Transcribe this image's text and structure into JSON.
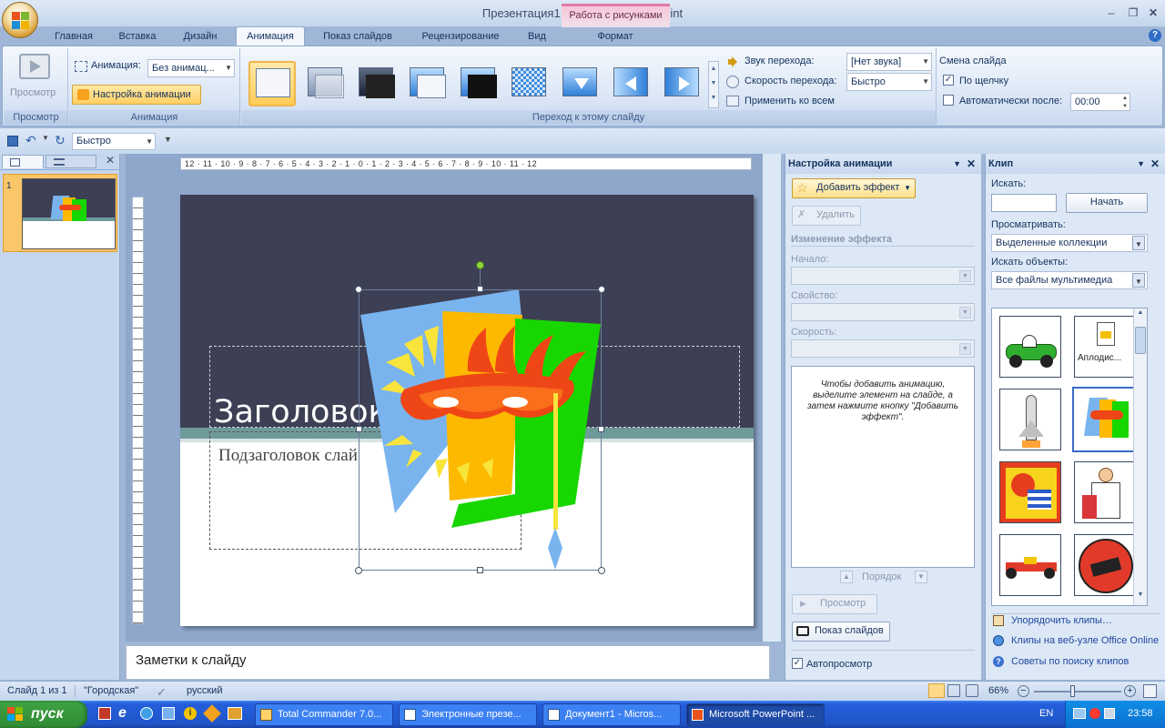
{
  "window": {
    "title": "Презентация1 - Microsoft PowerPoint",
    "context_tab_title": "Работа с рисунками"
  },
  "tabs": [
    "Главная",
    "Вставка",
    "Дизайн",
    "Анимация",
    "Показ слайдов",
    "Рецензирование",
    "Вид",
    "Формат"
  ],
  "active_tab": "Анимация",
  "ribbon": {
    "preview_label": "Просмотр",
    "preview_group": "Просмотр",
    "animation_label": "Анимация:",
    "animation_value": "Без анимац...",
    "custom_animation_label": "Настройка анимации",
    "animation_group": "Анимация",
    "transition_group": "Переход к этому слайду",
    "sound_label": "Звук перехода:",
    "sound_value": "[Нет звука]",
    "speed_label": "Скорость перехода:",
    "speed_value": "Быстро",
    "apply_all_label": "Применить ко всем",
    "advance_title": "Смена слайда",
    "on_click_label": "По щелчку",
    "on_click_checked": true,
    "auto_after_label": "Автоматически после:",
    "auto_after_checked": false,
    "auto_after_value": "00:00"
  },
  "qat": {
    "speed_value": "Быстро"
  },
  "slide": {
    "number": "1",
    "title": "Заголовок",
    "subtitle": "Подзаголовок слай",
    "notes_placeholder": "Заметки к слайду"
  },
  "ruler": {
    "h_ticks": "12 · 11 · 10 · 9 · 8 · 7 · 6 · 5 · 4 · 3 · 2 · 1 · 0 · 1 · 2 · 3 · 4 · 5 · 6 · 7 · 8 · 9 · 10 · 11 · 12"
  },
  "anim_pane": {
    "title": "Настройка анимации",
    "add_effect": "Добавить эффект",
    "remove": "Удалить",
    "change_effect": "Изменение эффекта",
    "start_label": "Начало:",
    "property_label": "Свойство:",
    "speed_label": "Скорость:",
    "hint": "Чтобы добавить анимацию, выделите элемент на слайде, а затем нажмите кнопку \"Добавить эффект\".",
    "order_label": "Порядок",
    "preview_button": "Просмотр",
    "slideshow_button": "Показ слайдов",
    "autopreview_label": "Автопросмотр",
    "autopreview_checked": true
  },
  "clip_pane": {
    "title": "Клип",
    "search_label": "Искать:",
    "search_value": "",
    "go_button": "Начать",
    "browse_label": "Просматривать:",
    "browse_value": "Выделенные коллекции",
    "find_label": "Искать объекты:",
    "find_value": "Все файлы мультимедиа",
    "clips": [
      "race car",
      "Аплодис...",
      "space shuttle",
      "carnival mask",
      "party balloons",
      "doctor and child",
      "formula car",
      "books and apple"
    ],
    "selected_clip": "carnival mask",
    "organize_link": "Упорядочить клипы…",
    "online_link": "Клипы на веб-узле Office Online",
    "tips_link": "Советы по поиску клипов"
  },
  "status": {
    "slide_info": "Слайд 1 из 1",
    "theme": "\"Городская\"",
    "language": "русский",
    "zoom": "66%"
  },
  "taskbar": {
    "start_label": "пуск",
    "tasks": [
      "Total Commander 7.0...",
      "Электронные презе...",
      "Документ1 - Micros...",
      "Microsoft PowerPoint ..."
    ],
    "active_task": "Microsoft PowerPoint ...",
    "lang": "EN",
    "clock": "23:58"
  },
  "colors": {
    "slide_top": "#3d3f55",
    "slide_band": "#6f9a9a",
    "accent_orange": "#f7b235",
    "mask_blue": "#7ab4ee",
    "mask_orange": "#fdb900",
    "mask_green": "#18d600",
    "mask_red": "#ef4617"
  }
}
